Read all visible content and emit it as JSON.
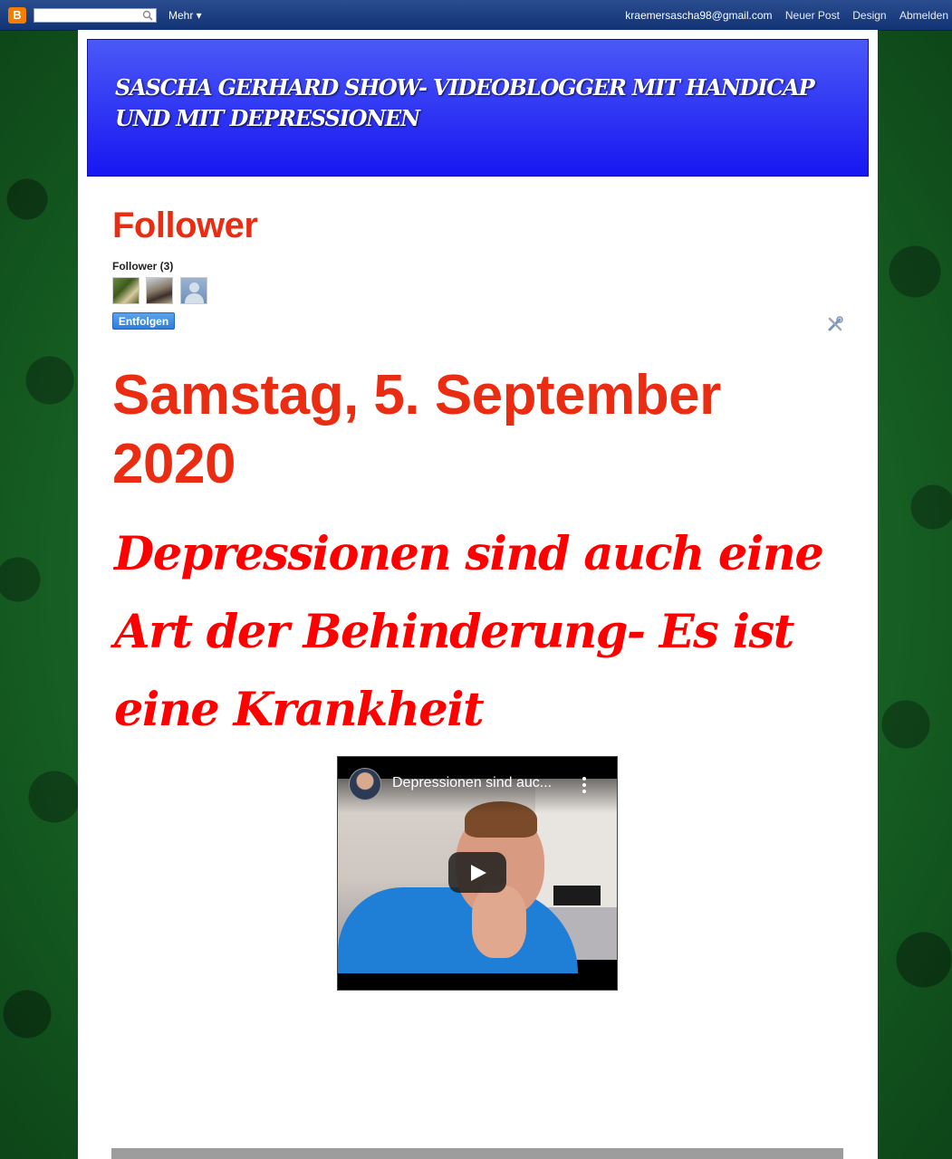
{
  "navbar": {
    "logo": "B",
    "search_placeholder": "",
    "more_label": "Mehr ▾",
    "email": "kraemersascha98@gmail.com",
    "new_post": "Neuer Post",
    "design": "Design",
    "logout": "Abmelden"
  },
  "blog": {
    "title": "SASCHA GERHARD SHOW- VIDEOBLOGGER MIT HANDICAP UND MIT DEPRESSIONEN"
  },
  "followers": {
    "heading": "Follower",
    "count_label": "Follower (3)",
    "unfollow_label": "Entfolgen",
    "avatars": [
      "follower-avatar-1",
      "follower-avatar-2",
      "follower-avatar-default"
    ]
  },
  "post": {
    "date": "Samstag, 5. September 2020",
    "title": "Depressionen sind auch eine Art der Behinderung- Es ist eine Krankheit",
    "video": {
      "title": "Depressionen sind auc...",
      "icons": [
        "channel-avatar",
        "more-vert-icon",
        "play-icon"
      ]
    }
  },
  "colors": {
    "accent_red": "#ea2c12",
    "title_red": "#ff0000",
    "header_blue": "#1717f2",
    "navbar_blue": "#123374",
    "button_blue": "#2c7fdc"
  }
}
